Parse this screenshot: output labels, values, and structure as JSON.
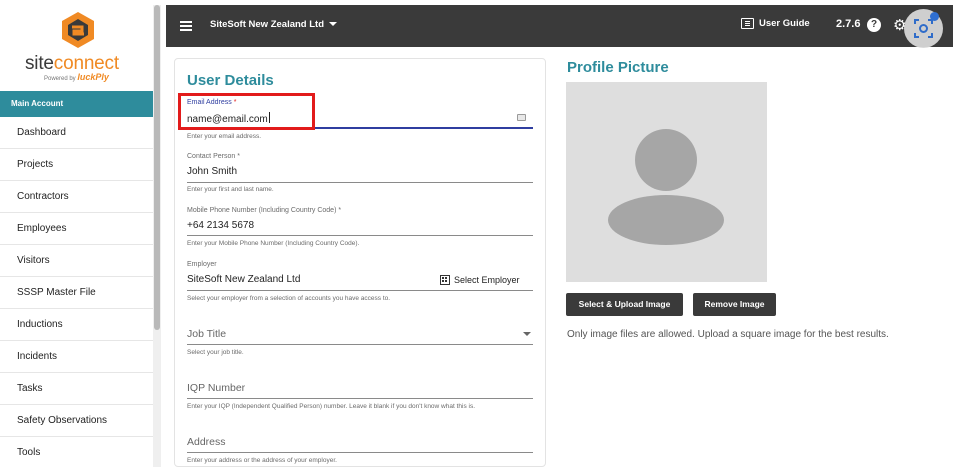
{
  "app": {
    "logo_text_a": "site",
    "logo_text_b": "connect",
    "powered_by": "Powered by",
    "powered_brand": "luckPly"
  },
  "sidebar": {
    "section_title": "Main Account",
    "items": [
      {
        "label": "Dashboard"
      },
      {
        "label": "Projects"
      },
      {
        "label": "Contractors"
      },
      {
        "label": "Employees"
      },
      {
        "label": "Visitors"
      },
      {
        "label": "SSSP Master File"
      },
      {
        "label": "Inductions"
      },
      {
        "label": "Incidents"
      },
      {
        "label": "Tasks"
      },
      {
        "label": "Safety Observations"
      },
      {
        "label": "Tools"
      }
    ]
  },
  "header": {
    "company": "SiteSoft New Zealand Ltd",
    "user_guide": "User Guide",
    "version": "2.7.6",
    "help_glyph": "?"
  },
  "form": {
    "title": "User Details",
    "email": {
      "label": "Email Address",
      "required_mark": "*",
      "value": "name@email.com",
      "helper": "Enter your email address."
    },
    "contact": {
      "label": "Contact Person *",
      "value": "John Smith",
      "helper": "Enter your first and last name."
    },
    "mobile": {
      "label": "Mobile Phone Number (Including Country Code)  *",
      "value": "+64 2134 5678",
      "helper": "Enter your Mobile Phone Number (Including Country Code)."
    },
    "employer": {
      "label": "Employer",
      "value": "SiteSoft New Zealand Ltd",
      "action": "Select Employer",
      "helper": "Select your employer from a selection of accounts you have access to."
    },
    "job_title": {
      "placeholder": "Job Title",
      "helper": "Select your job title."
    },
    "iqp": {
      "placeholder": "IQP Number",
      "helper": "Enter your IQP (Independent Qualified Person) number. Leave it blank if you don't know what this is."
    },
    "address": {
      "placeholder": "Address",
      "helper": "Enter your address or the address of your employer."
    }
  },
  "profile": {
    "title": "Profile Picture",
    "upload_button": "Select & Upload Image",
    "remove_button": "Remove Image",
    "note": "Only image files are allowed. Upload a square image for the best results."
  },
  "colors": {
    "accent": "#2e8c9c",
    "header_bg": "#3a3a3a",
    "brand_orange": "#f08a24",
    "highlight_red": "#e21b1b",
    "focus_blue": "#2f3ea0"
  },
  "icons": [
    "hamburger-icon",
    "caret-down-icon",
    "book-icon",
    "help-icon",
    "gear-icon",
    "screenshot-icon",
    "building-icon",
    "autofill-icon",
    "avatar-placeholder"
  ]
}
